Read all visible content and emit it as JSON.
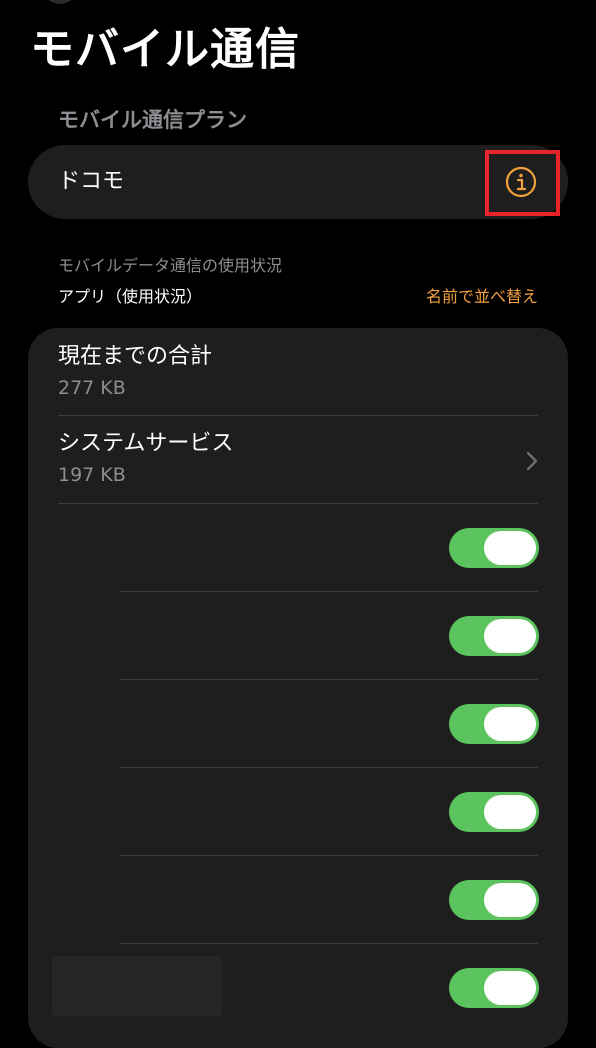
{
  "page": {
    "title": "モバイル通信"
  },
  "plan_section": {
    "header": "モバイル通信プラン",
    "plan_name": "ドコモ",
    "info_icon": "info-circle-icon",
    "accent_color": "#f2a03d",
    "highlight_color": "#e8232a"
  },
  "usage_section": {
    "header": "モバイルデータ通信の使用状況",
    "apps_label": "アプリ（使用状況）",
    "sort_label": "名前で並べ替え"
  },
  "usage_rows": [
    {
      "title": "現在までの合計",
      "value": "277 KB"
    },
    {
      "title": "システムサービス",
      "value": "197 KB",
      "icon": "chevron-right-icon"
    }
  ],
  "app_toggles": [
    {
      "on": true
    },
    {
      "on": true
    },
    {
      "on": true
    },
    {
      "on": true
    },
    {
      "on": true
    },
    {
      "on": true
    }
  ],
  "colors": {
    "background": "#000000",
    "card": "#1e1e1e",
    "toggle_on": "#5bc45e",
    "secondary_text": "#8d8d92"
  }
}
